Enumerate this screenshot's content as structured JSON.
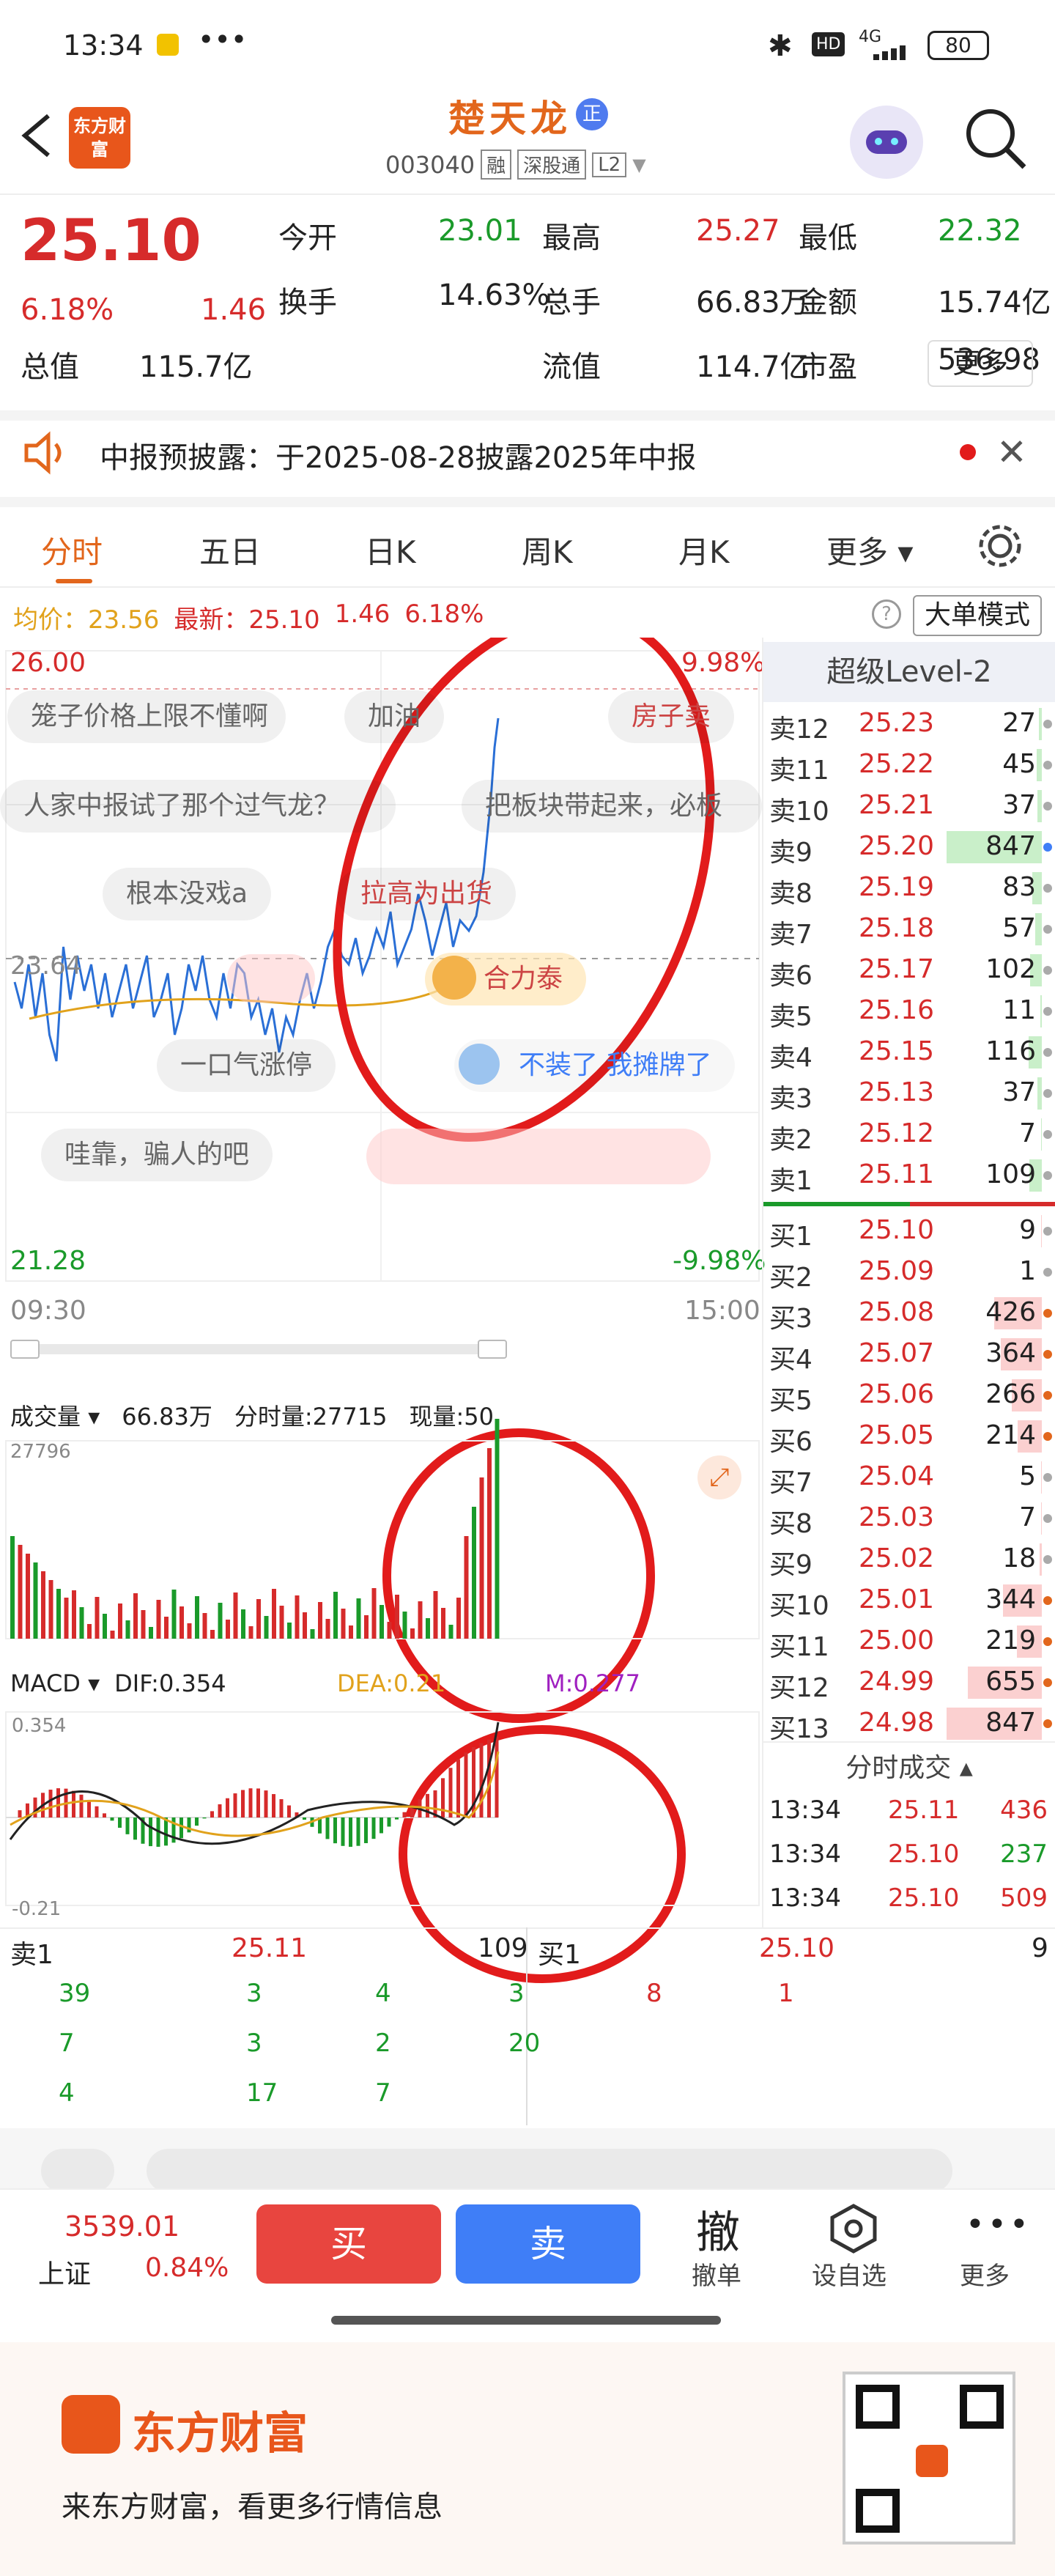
{
  "status_bar": {
    "time": "13:34",
    "indicators": "4G",
    "battery": "80"
  },
  "header": {
    "title": "楚天龙",
    "badge": "正",
    "code": "003040",
    "tags": [
      "融",
      "深股通",
      "L2"
    ],
    "logo_text": "东方财富"
  },
  "quote": {
    "price": "25.10",
    "change_pct": "6.18%",
    "change": "1.46",
    "rows": [
      [
        {
          "k": "今开",
          "v": "23.01",
          "c": "green"
        },
        {
          "k": "最高",
          "v": "25.27",
          "c": "red"
        },
        {
          "k": "最低",
          "v": "22.32",
          "c": "green"
        }
      ],
      [
        {
          "k": "换手",
          "v": "14.63%",
          "c": ""
        },
        {
          "k": "总手",
          "v": "66.83万",
          "c": ""
        },
        {
          "k": "金额",
          "v": "15.74亿",
          "c": ""
        }
      ],
      [
        {
          "k": "总值",
          "v": "115.7亿",
          "c": ""
        },
        {
          "k": "流值",
          "v": "114.7亿",
          "c": ""
        },
        {
          "k": "市盈",
          "v": "536.98",
          "c": ""
        }
      ]
    ],
    "more_label": "更多"
  },
  "notice": {
    "text": "中报预披露：于2025-08-28披露2025年中报"
  },
  "tabs": [
    "分时",
    "五日",
    "日K",
    "周K",
    "月K",
    "更多"
  ],
  "chart_header": {
    "avg_label": "均价：23.56",
    "last_label": "最新：25.10",
    "chg": "1.46",
    "chg_pct": "6.18%",
    "mode_label": "大单模式"
  },
  "chart": {
    "top_price": "26.00",
    "top_pct": "9.98%",
    "bottom_price": "21.28",
    "bottom_pct": "-9.98%",
    "mid_price": "23.64",
    "start_time": "09:30",
    "end_time": "15:00"
  },
  "danmu": [
    "笼子价格上限不懂啊",
    "加油",
    "房子卖",
    "人家中报试了那个过气龙？",
    "把板块带起来，必板",
    "根本没戏a",
    "拉高为出货",
    "合力泰",
    "一口气涨停",
    "不装了 我摊牌了",
    "哇靠，骗人的吧"
  ],
  "volume": {
    "label": "成交量",
    "total": "66.83万",
    "fs_label": "分时量:27715",
    "now_label": "现量:50",
    "max": "27796"
  },
  "macd": {
    "label": "MACD",
    "dif": "DIF:0.354",
    "dea": "DEA:0.21",
    "m": "M:0.277",
    "top": "0.354",
    "bottom": "-0.21"
  },
  "level2": {
    "title": "超级Level-2",
    "asks": [
      [
        "卖12",
        "25.23",
        "27"
      ],
      [
        "卖11",
        "25.22",
        "45"
      ],
      [
        "卖10",
        "25.21",
        "37"
      ],
      [
        "卖9",
        "25.20",
        "847"
      ],
      [
        "卖8",
        "25.19",
        "83"
      ],
      [
        "卖7",
        "25.18",
        "57"
      ],
      [
        "卖6",
        "25.17",
        "102"
      ],
      [
        "卖5",
        "25.16",
        "11"
      ],
      [
        "卖4",
        "25.15",
        "116"
      ],
      [
        "卖3",
        "25.13",
        "37"
      ],
      [
        "卖2",
        "25.12",
        "7"
      ],
      [
        "卖1",
        "25.11",
        "109"
      ]
    ],
    "bids": [
      [
        "买1",
        "25.10",
        "9"
      ],
      [
        "买2",
        "25.09",
        "1"
      ],
      [
        "买3",
        "25.08",
        "426"
      ],
      [
        "买4",
        "25.07",
        "364"
      ],
      [
        "买5",
        "25.06",
        "266"
      ],
      [
        "买6",
        "25.05",
        "214"
      ],
      [
        "买7",
        "25.04",
        "5"
      ],
      [
        "买8",
        "25.03",
        "7"
      ],
      [
        "买9",
        "25.02",
        "18"
      ],
      [
        "买10",
        "25.01",
        "344"
      ],
      [
        "买11",
        "25.00",
        "219"
      ],
      [
        "买12",
        "24.99",
        "655"
      ],
      [
        "买13",
        "24.98",
        "847"
      ]
    ],
    "trades_title": "分时成交",
    "trades": [
      [
        "13:34",
        "25.11",
        "436"
      ],
      [
        "13:34",
        "25.10",
        "237"
      ],
      [
        "13:34",
        "25.10",
        "509"
      ]
    ]
  },
  "queue": {
    "sell_label": "卖1",
    "sell_price": "25.11",
    "sell_vol": "109",
    "buy_label": "买1",
    "buy_price": "25.10",
    "buy_vol": "9",
    "sell_rows": [
      [
        "39",
        "3",
        "4",
        "3"
      ],
      [
        "7",
        "3",
        "2",
        "20"
      ],
      [
        "4",
        "17",
        "7",
        ""
      ]
    ],
    "buy_rows": [
      [
        "8",
        "1"
      ]
    ]
  },
  "bottom": {
    "index_value": "3539.01",
    "index_name": "上证",
    "index_pct": "0.84%",
    "buy": "买",
    "sell": "卖",
    "cancel_icon": "撤",
    "cancel": "撤单",
    "watch": "设自选",
    "more": "更多"
  },
  "footer": {
    "brand": "东方财富",
    "slogan": "来东方财富，看更多行情信息"
  },
  "colors": {
    "red": "#d62b2b",
    "green": "#1a9a2a",
    "orange": "#e2661c",
    "blue": "#3f7ef7"
  }
}
